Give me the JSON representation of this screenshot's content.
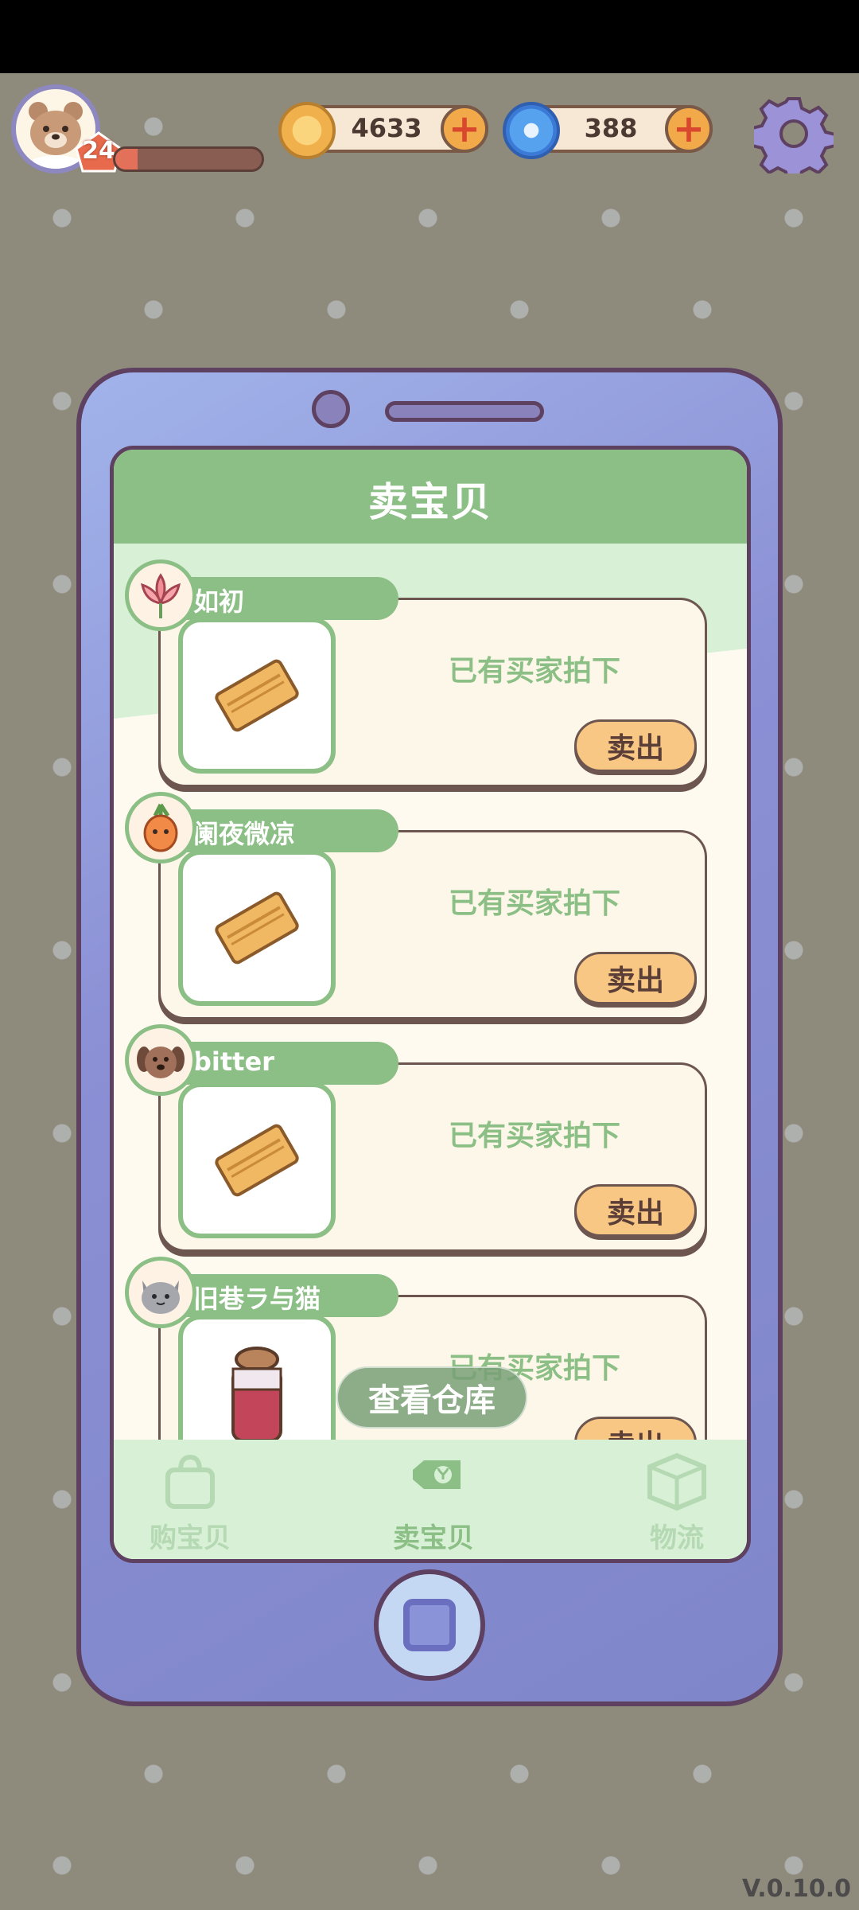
{
  "hud": {
    "level": "24",
    "xp_progress": 0.15,
    "coins": "4633",
    "gems": "388"
  },
  "screen": {
    "title": "卖宝贝",
    "warehouse_button": "查看仓库"
  },
  "listings": [
    {
      "seller": "如初",
      "seller_icon": "lotus-icon",
      "item_icon": "wrapped-parcel-icon",
      "status": "已有买家拍下",
      "action": "卖出"
    },
    {
      "seller": "阑夜微凉",
      "seller_icon": "carrot-icon",
      "item_icon": "wrapped-parcel-icon",
      "status": "已有买家拍下",
      "action": "卖出"
    },
    {
      "seller": "bitter",
      "seller_icon": "dog-icon",
      "item_icon": "wrapped-parcel-icon",
      "status": "已有买家拍下",
      "action": "卖出"
    },
    {
      "seller": "旧巷ラ与猫",
      "seller_icon": "cat-icon",
      "item_icon": "jam-jar-icon",
      "status": "已有买家拍下",
      "action": "卖出"
    }
  ],
  "tabs": [
    {
      "label": "购宝贝",
      "icon": "shopping-bag-icon",
      "active": false
    },
    {
      "label": "卖宝贝",
      "icon": "price-tag-icon",
      "active": true
    },
    {
      "label": "物流",
      "icon": "box-icon",
      "active": false
    }
  ],
  "version": "V.0.10.0",
  "colors": {
    "accent_green": "#8cbf85",
    "light_green": "#d7f0d6",
    "phone_purple": "#8b8fd4",
    "sell_button": "#f8c783"
  }
}
